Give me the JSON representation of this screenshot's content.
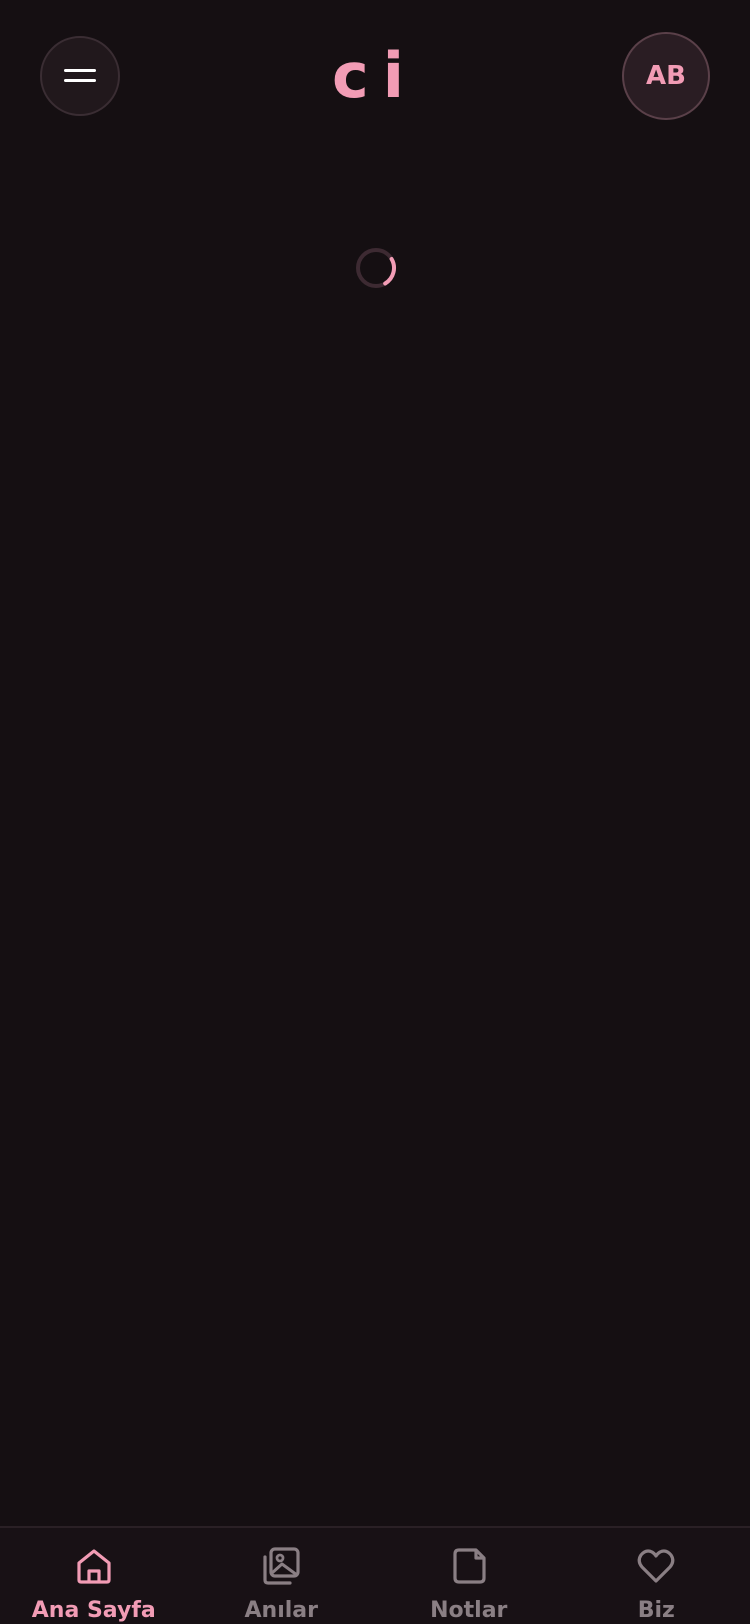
{
  "header": {
    "logo_text": "ci",
    "avatar_initials": "AB"
  },
  "icons": {
    "menu": "hamburger-icon",
    "spinner": "loading-spinner-icon"
  },
  "bottom_nav": {
    "items": [
      {
        "label": "Ana Sayfa",
        "icon": "home-icon",
        "active": true
      },
      {
        "label": "Anılar",
        "icon": "gallery-icon",
        "active": false
      },
      {
        "label": "Notlar",
        "icon": "note-icon",
        "active": false
      },
      {
        "label": "Biz",
        "icon": "heart-icon",
        "active": false
      }
    ]
  },
  "colors": {
    "background": "#150f12",
    "accent": "#f29cb5",
    "inactive": "#8a7f84",
    "surface": "#21181c"
  }
}
